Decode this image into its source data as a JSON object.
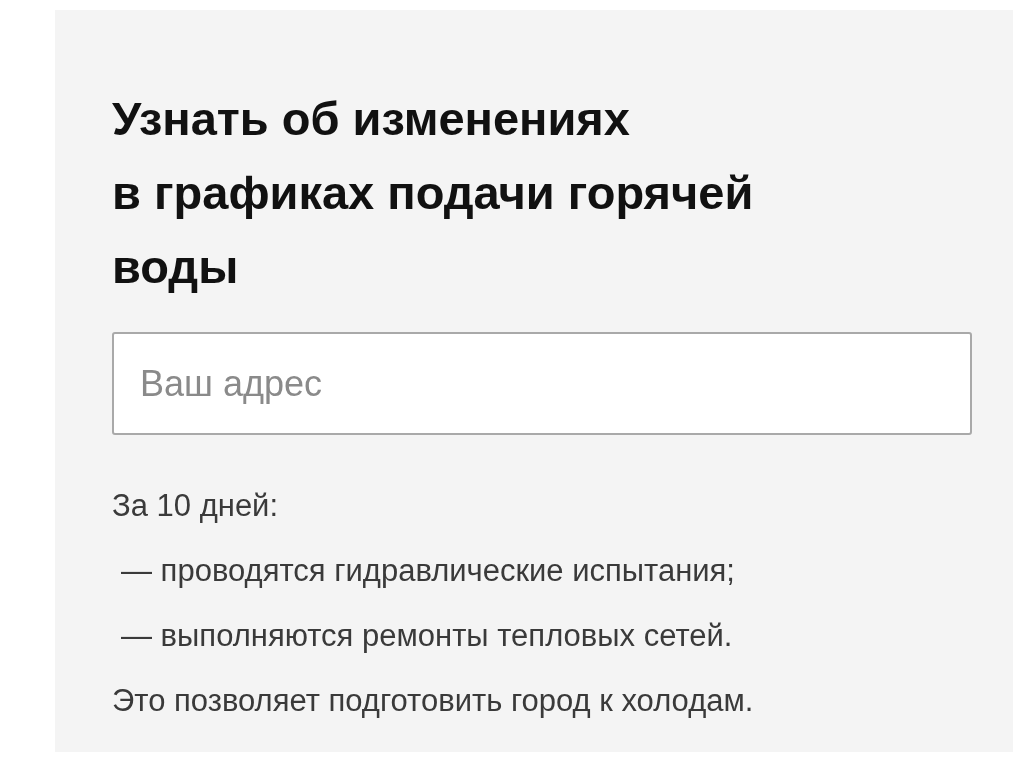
{
  "heading": {
    "lines": [
      "Узнать об изменениях",
      "в графиках подачи горячей",
      "воды"
    ]
  },
  "address_field": {
    "placeholder": "Ваш адрес"
  },
  "info": {
    "intro": "За 10 дней:",
    "items": [
      "— проводятся гидравлические испытания;",
      "— выполняются ремонты тепловых сетей."
    ],
    "outro": "Это позволяет подготовить город к холодам."
  }
}
